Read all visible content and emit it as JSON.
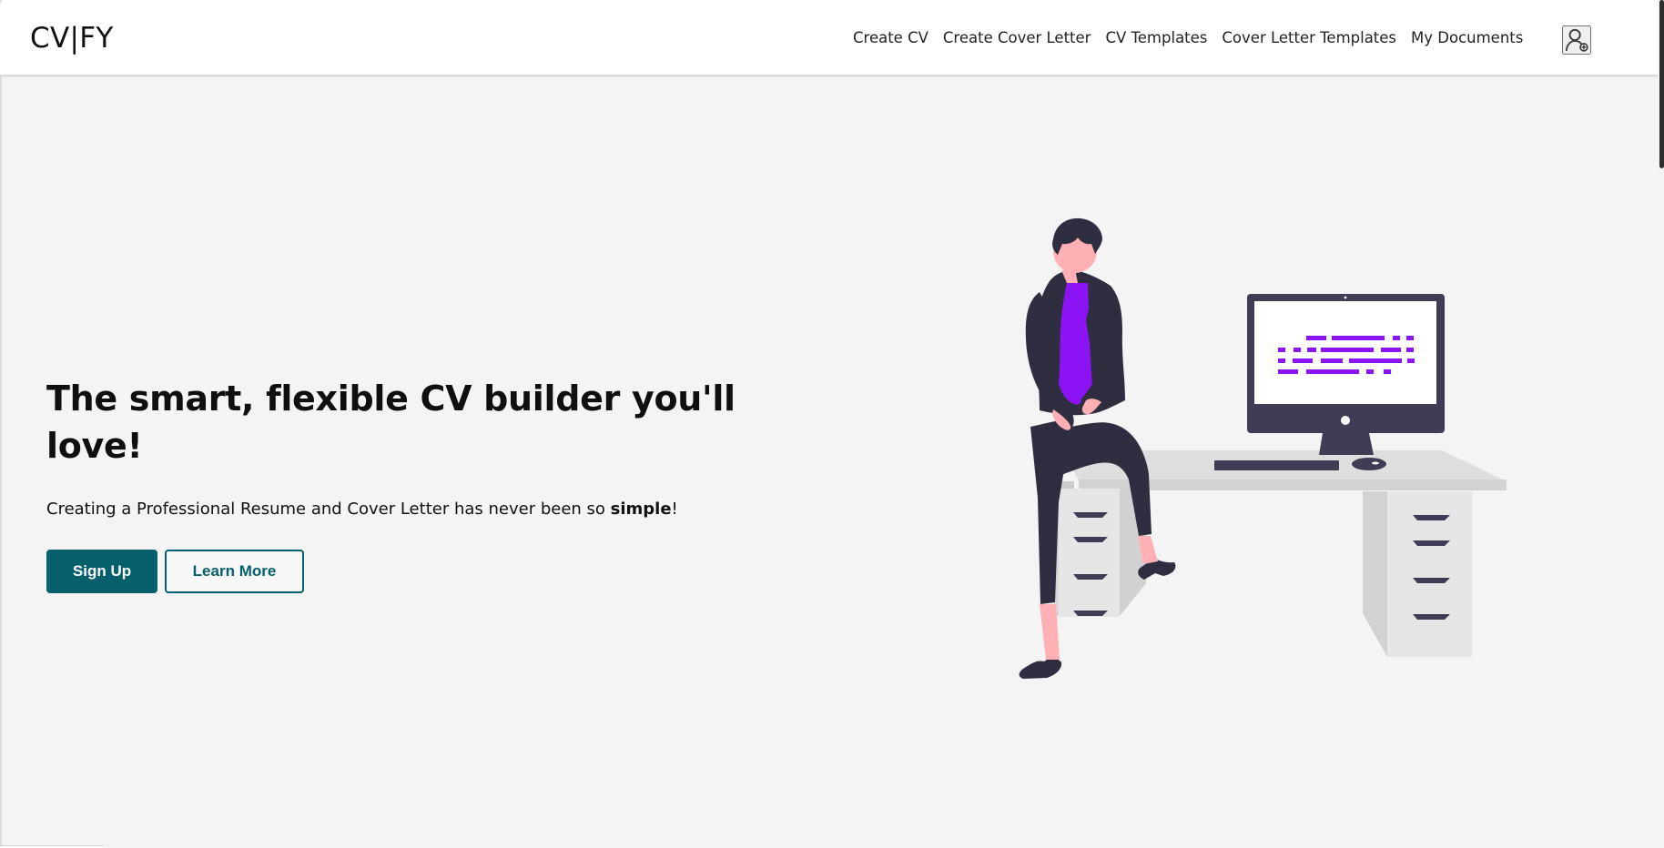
{
  "navbar": {
    "brand": "CV|FY",
    "links": [
      {
        "label": "Create CV"
      },
      {
        "label": "Create Cover Letter"
      },
      {
        "label": "CV Templates"
      },
      {
        "label": "Cover Letter Templates"
      },
      {
        "label": "My Documents"
      }
    ],
    "user_icon": "user-add-icon"
  },
  "hero": {
    "title": "The smart, flexible CV builder you'll love!",
    "text_before": "Creating a Professional Resume and Cover Letter has never been so ",
    "text_bold": "simple",
    "text_after": "!",
    "signup_label": "Sign Up",
    "learn_more_label": "Learn More"
  },
  "illustration": {
    "name": "person-with-computer-illustration"
  },
  "colors": {
    "primary": "#06606c",
    "page_background": "#f4f4f4",
    "accent_purple": "#8b13f4"
  }
}
